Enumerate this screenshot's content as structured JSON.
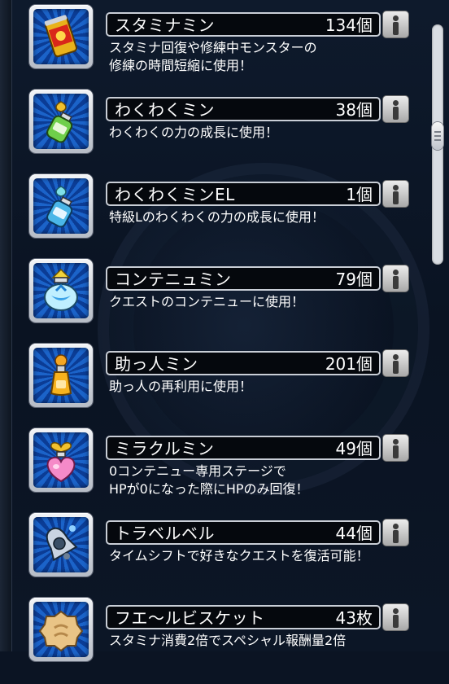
{
  "items": [
    {
      "name": "スタミナミン",
      "count": "134個",
      "desc1": "スタミナ回復や修練中モンスターの",
      "desc2": "修練の時間短縮に使用！",
      "icon": "stamina-can-icon"
    },
    {
      "name": "わくわくミン",
      "count": "38個",
      "desc1": "わくわくの力の成長に使用！",
      "desc2": "",
      "icon": "green-bottle-icon"
    },
    {
      "name": "わくわくミンEL",
      "count": "1個",
      "desc1": "特級Lのわくわくの力の成長に使用！",
      "desc2": "",
      "icon": "blue-bottle-el-icon"
    },
    {
      "name": "コンテニュミン",
      "count": "79個",
      "desc1": "クエストのコンテニューに使用！",
      "desc2": "",
      "icon": "continue-jar-icon"
    },
    {
      "name": "助っ人ミン",
      "count": "201個",
      "desc1": "助っ人の再利用に使用！",
      "desc2": "",
      "icon": "orange-flask-icon"
    },
    {
      "name": "ミラクルミン",
      "count": "49個",
      "desc1": "0コンテニュー専用ステージで",
      "desc2": "HPが0になった際にHPのみ回復！",
      "icon": "heart-potion-icon"
    },
    {
      "name": "トラベルベル",
      "count": "44個",
      "desc1": "タイムシフトで好きなクエストを復活可能！",
      "desc2": "",
      "icon": "bell-icon"
    },
    {
      "name": "フエ〜ルビスケット",
      "count": "43枚",
      "desc1": "スタミナ消費2倍でスペシャル報酬量2倍",
      "desc2": "",
      "icon": "biscuit-icon"
    }
  ]
}
